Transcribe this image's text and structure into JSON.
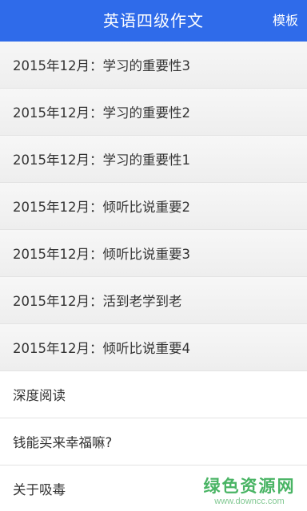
{
  "header": {
    "title": "英语四级作文",
    "action_label": "模板"
  },
  "articles": [
    {
      "title": "2015年12月：学习的重要性3"
    },
    {
      "title": "2015年12月：学习的重要性2"
    },
    {
      "title": "2015年12月：学习的重要性1"
    },
    {
      "title": "2015年12月：倾听比说重要2"
    },
    {
      "title": "2015年12月：倾听比说重要3"
    },
    {
      "title": "2015年12月：活到老学到老"
    },
    {
      "title": "2015年12月：倾听比说重要4"
    },
    {
      "title": "深度阅读"
    },
    {
      "title": "钱能买来幸福嘛?"
    },
    {
      "title": "关于吸毒"
    }
  ],
  "watermark": {
    "main": "绿色资源网",
    "sub": "www.downcc.com"
  },
  "colors": {
    "header_bg": "#2f6bea",
    "watermark": "#2aa84a"
  }
}
